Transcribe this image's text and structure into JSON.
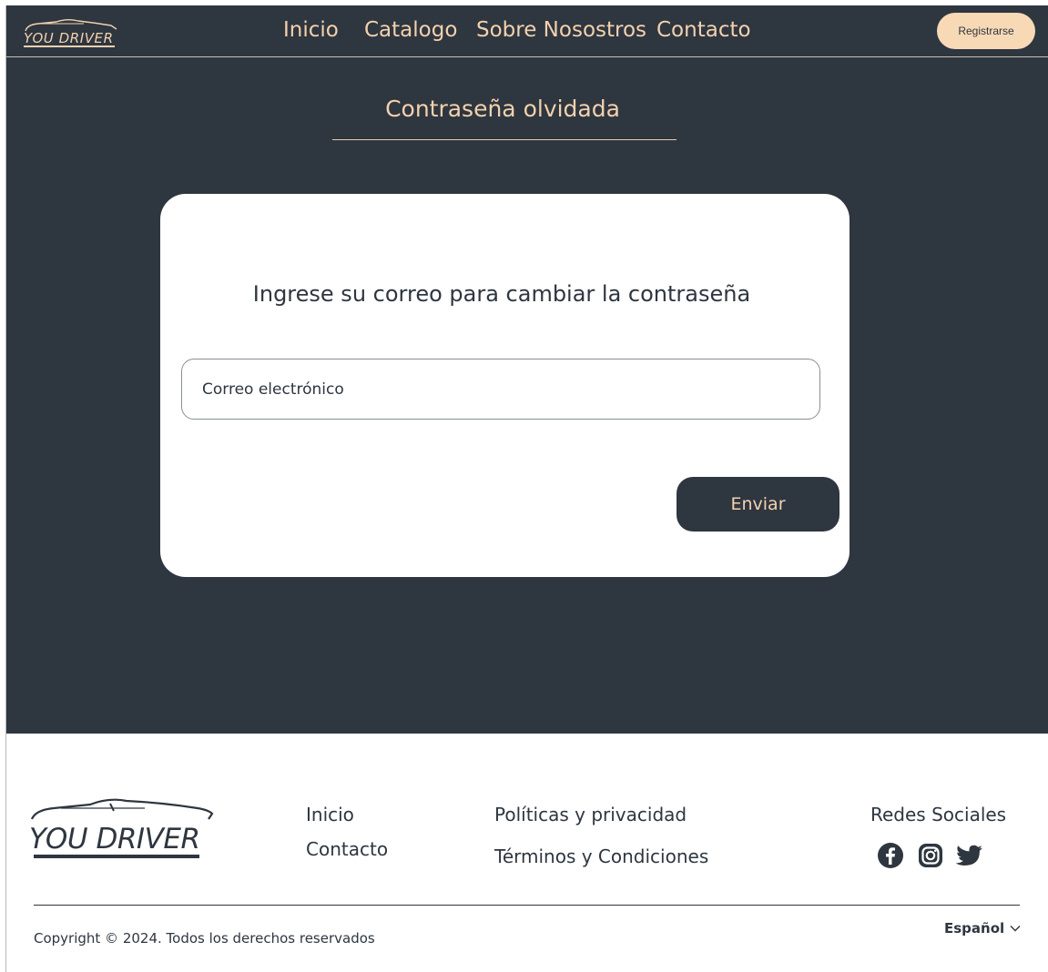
{
  "brand": {
    "name": "YOU DRIVER"
  },
  "nav": {
    "items": [
      {
        "label": "Inicio"
      },
      {
        "label": "Catalogo"
      },
      {
        "label": "Sobre Nosostros"
      },
      {
        "label": "Contacto"
      }
    ],
    "register_label": "Registrarse"
  },
  "main": {
    "title": "Contraseña olvidada",
    "card": {
      "heading": "Ingrese su correo para cambiar la contraseña",
      "email_placeholder": "Correo electrónico",
      "email_value": "",
      "submit_label": "Enviar"
    }
  },
  "footer": {
    "links_col1": [
      {
        "label": "Inicio"
      },
      {
        "label": "Contacto"
      }
    ],
    "links_col2": [
      {
        "label": "Políticas y privacidad"
      },
      {
        "label": "Términos y Condiciones"
      }
    ],
    "social_title": "Redes Sociales",
    "social_icons": [
      "facebook-icon",
      "instagram-icon",
      "twitter-icon"
    ],
    "copyright": "Copyright © 2024. Todos los derechos reservados",
    "language": "Español"
  },
  "colors": {
    "primary_dark": "#2e3640",
    "accent_peach": "#f3d1ad",
    "button_peach": "#f8d9b6",
    "surface": "#ffffff"
  }
}
